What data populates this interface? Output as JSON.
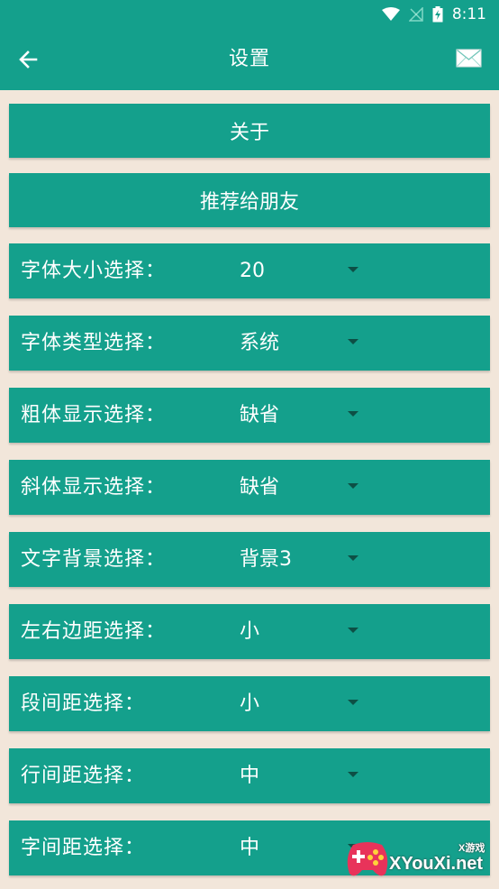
{
  "status_bar": {
    "time": "8:11",
    "icons": [
      "wifi-icon",
      "no-signal-icon",
      "battery-charging-icon"
    ]
  },
  "app_bar": {
    "title": "设置",
    "back_icon": "arrow-left-icon",
    "action_icon": "mail-icon"
  },
  "buttons": [
    {
      "label": "关于"
    },
    {
      "label": "推荐给朋友"
    }
  ],
  "settings": [
    {
      "label": "字体大小选择：",
      "value": "20"
    },
    {
      "label": "字体类型选择：",
      "value": "系统"
    },
    {
      "label": "粗体显示选择：",
      "value": "缺省"
    },
    {
      "label": "斜体显示选择：",
      "value": "缺省"
    },
    {
      "label": "文字背景选择：",
      "value": "背景3"
    },
    {
      "label": "左右边距选择：",
      "value": "小"
    },
    {
      "label": "段间距选择：",
      "value": "小"
    },
    {
      "label": "行间距选择：",
      "value": "中"
    },
    {
      "label": "字间距选择：",
      "value": "中"
    }
  ],
  "watermark": {
    "text": "XYouXi.net",
    "small_text": "X游戏"
  },
  "colors": {
    "primary": "#14a08c",
    "background": "#f2e6da",
    "arrow": "#0d4f45"
  }
}
